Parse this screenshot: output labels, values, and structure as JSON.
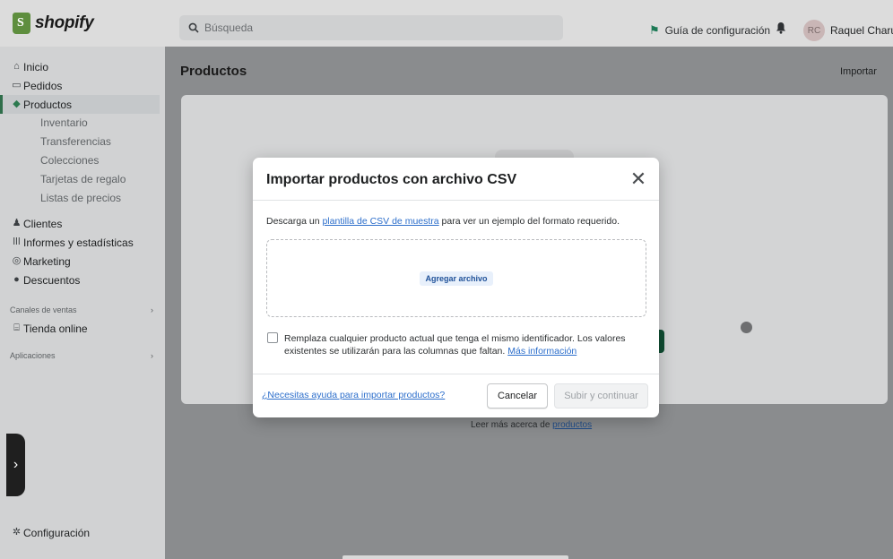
{
  "topbar": {
    "logo_text": "shopify",
    "search_placeholder": "Búsqueda",
    "setup_guide": "Guía de configuración",
    "avatar_initials": "RC",
    "user_name": "Raquel Charua"
  },
  "sidebar": {
    "items": [
      {
        "label": "Inicio",
        "icon": "home-icon"
      },
      {
        "label": "Pedidos",
        "icon": "orders-icon"
      },
      {
        "label": "Productos",
        "icon": "tag-icon"
      }
    ],
    "product_subitems": [
      "Inventario",
      "Transferencias",
      "Colecciones",
      "Tarjetas de regalo",
      "Listas de precios"
    ],
    "items2": [
      {
        "label": "Clientes",
        "icon": "person-icon"
      },
      {
        "label": "Informes y estadísticas",
        "icon": "bar-chart-icon"
      },
      {
        "label": "Marketing",
        "icon": "target-icon"
      },
      {
        "label": "Descuentos",
        "icon": "discount-icon"
      }
    ],
    "sales_channels_label": "Canales de ventas",
    "online_store": "Tienda online",
    "apps_label": "Aplicaciones",
    "settings": "Configuración"
  },
  "main": {
    "title": "Productos",
    "import": "Importar",
    "learn_prefix": "Leer más acerca de",
    "learn_link": "productos"
  },
  "modal": {
    "title": "Importar productos con archivo CSV",
    "desc_prefix": "Descarga un",
    "desc_link": "plantilla de CSV de muestra",
    "desc_suffix": "para ver un ejemplo del formato requerido.",
    "add_file": "Agregar archivo",
    "overwrite_text": "Remplaza cualquier producto actual que tenga el mismo identificador. Los valores existentes se utilizarán para las columnas que faltan.",
    "more_info": "Más información",
    "help_link": "¿Necesitas ayuda para importar productos?",
    "cancel": "Cancelar",
    "submit": "Subir y continuar"
  },
  "colors": {
    "accent_green": "#2c7a4f",
    "link_blue": "#2c6ecb"
  }
}
